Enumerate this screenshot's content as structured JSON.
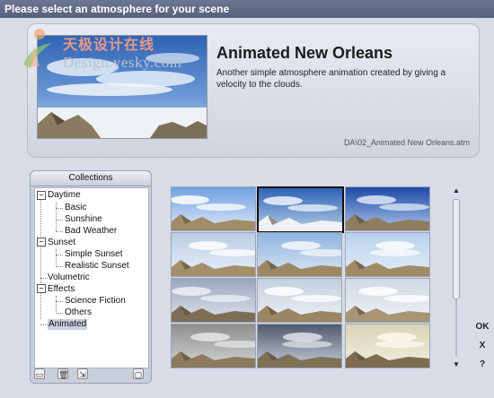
{
  "dialog": {
    "title": "Please select an atmosphere for your scene"
  },
  "watermark": {
    "chinese": "天极设计在线",
    "english": "Design.yesky.com"
  },
  "preview": {
    "title": "Animated New Orleans",
    "description": "Another simple atmosphere animation created by giving a velocity to the clouds.",
    "filename": "DA\\02_Animated New Orleans.atm"
  },
  "collections": {
    "header": "Collections",
    "tree": [
      {
        "label": "Daytime",
        "expander": "−",
        "children": [
          "Basic",
          "Sunshine",
          "Bad Weather"
        ]
      },
      {
        "label": "Sunset",
        "expander": "−",
        "children": [
          "Simple Sunset",
          "Realistic Sunset"
        ]
      },
      {
        "label": "Volumetric"
      },
      {
        "label": "Effects",
        "expander": "−",
        "children": [
          "Science Fiction",
          "Others"
        ]
      },
      {
        "label": "Animated",
        "selected": true
      }
    ],
    "toolbar_icons": [
      "new-collection-icon",
      "delete-icon",
      "import-icon",
      "lock-icon"
    ]
  },
  "thumbnails": {
    "selected_index": 1,
    "count": 12
  },
  "side_buttons": {
    "ok": "OK",
    "close": "X",
    "help": "?"
  },
  "scroll_arrows": {
    "up": "▲",
    "down": "▼"
  },
  "tree_symbols": {
    "minus": "−"
  },
  "toolbar_glyphs": {
    "new": "▭",
    "delete": "🗑",
    "import": "⇲",
    "lock": "▢"
  }
}
